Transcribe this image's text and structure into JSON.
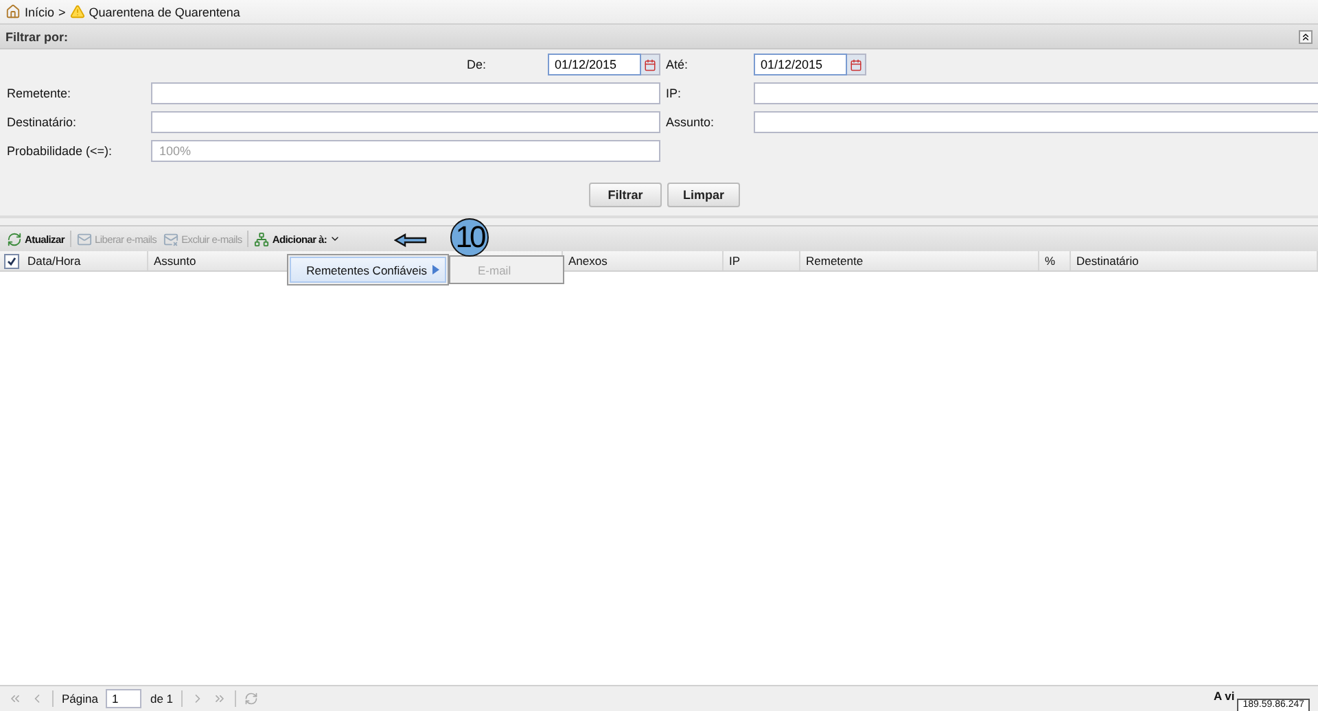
{
  "breadcrumb": {
    "separator": ">",
    "items": [
      {
        "label": "Início"
      },
      {
        "label": "Quarentena de Quarentena"
      }
    ]
  },
  "filter": {
    "title": "Filtrar por:",
    "fields": [
      {
        "kind": "date",
        "label": "De:",
        "value": "01/12/2015"
      },
      {
        "kind": "date",
        "label": "Até:",
        "value": "01/12/2015"
      },
      {
        "kind": "text",
        "label": "Remetente:"
      },
      {
        "kind": "text",
        "label": "IP:"
      },
      {
        "kind": "text",
        "label": "Destinatário:"
      },
      {
        "kind": "text",
        "label": "Assunto:"
      },
      {
        "kind": "text",
        "label": "Probabilidade (<=):",
        "placeholder": "100%"
      }
    ],
    "buttons": [
      "Filtrar",
      "Limpar"
    ]
  },
  "toolbar": [
    {
      "kind": "button",
      "label": "Atualizar",
      "disabled": false
    },
    {
      "kind": "button",
      "label": "Liberar e-mails",
      "disabled": true
    },
    {
      "kind": "button",
      "label": "Excluir e-mails",
      "disabled": true
    },
    {
      "kind": "menu",
      "label": "Adicionar à:",
      "disabled": false
    }
  ],
  "menu": {
    "items": [
      {
        "label": "Remetentes Confiáveis",
        "selected": true
      }
    ],
    "submenu": [
      {
        "label": "E-mail",
        "disabled": true
      }
    ]
  },
  "annotation": {
    "number": "10"
  },
  "grid": {
    "select_all": {
      "checked": true
    },
    "columns": [
      "Data/Hora",
      "Assunto",
      "Anexos",
      "IP",
      "Remetente",
      "%",
      "Destinatário"
    ]
  },
  "pager": {
    "page_label": "Página",
    "page": "1",
    "of_label": "de 1",
    "status": "A vi",
    "tooltip": "189.59.86.247"
  }
}
